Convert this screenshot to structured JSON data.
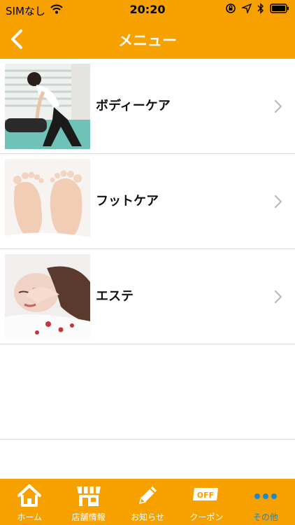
{
  "status_bar": {
    "carrier": "SIMなし",
    "time": "20:20"
  },
  "nav": {
    "title": "メニュー",
    "back_icon": "chevron-left-icon"
  },
  "menu": {
    "items": [
      {
        "label": "ボディーケア",
        "image": "body-care-photo"
      },
      {
        "label": "フットケア",
        "image": "foot-care-photo"
      },
      {
        "label": "エステ",
        "image": "esthetic-photo"
      }
    ]
  },
  "tabs": [
    {
      "label": "ホーム",
      "icon": "home-icon",
      "active": false
    },
    {
      "label": "店舗情報",
      "icon": "store-icon",
      "active": false
    },
    {
      "label": "お知らせ",
      "icon": "pencil-icon",
      "active": false
    },
    {
      "label": "クーポン",
      "icon": "coupon-off-icon",
      "active": false
    },
    {
      "label": "その他",
      "icon": "more-dots-icon",
      "active": true
    }
  ],
  "colors": {
    "brand": "#f7a100",
    "active_tab": "#1e88c8",
    "divider": "#dcdcdc"
  }
}
